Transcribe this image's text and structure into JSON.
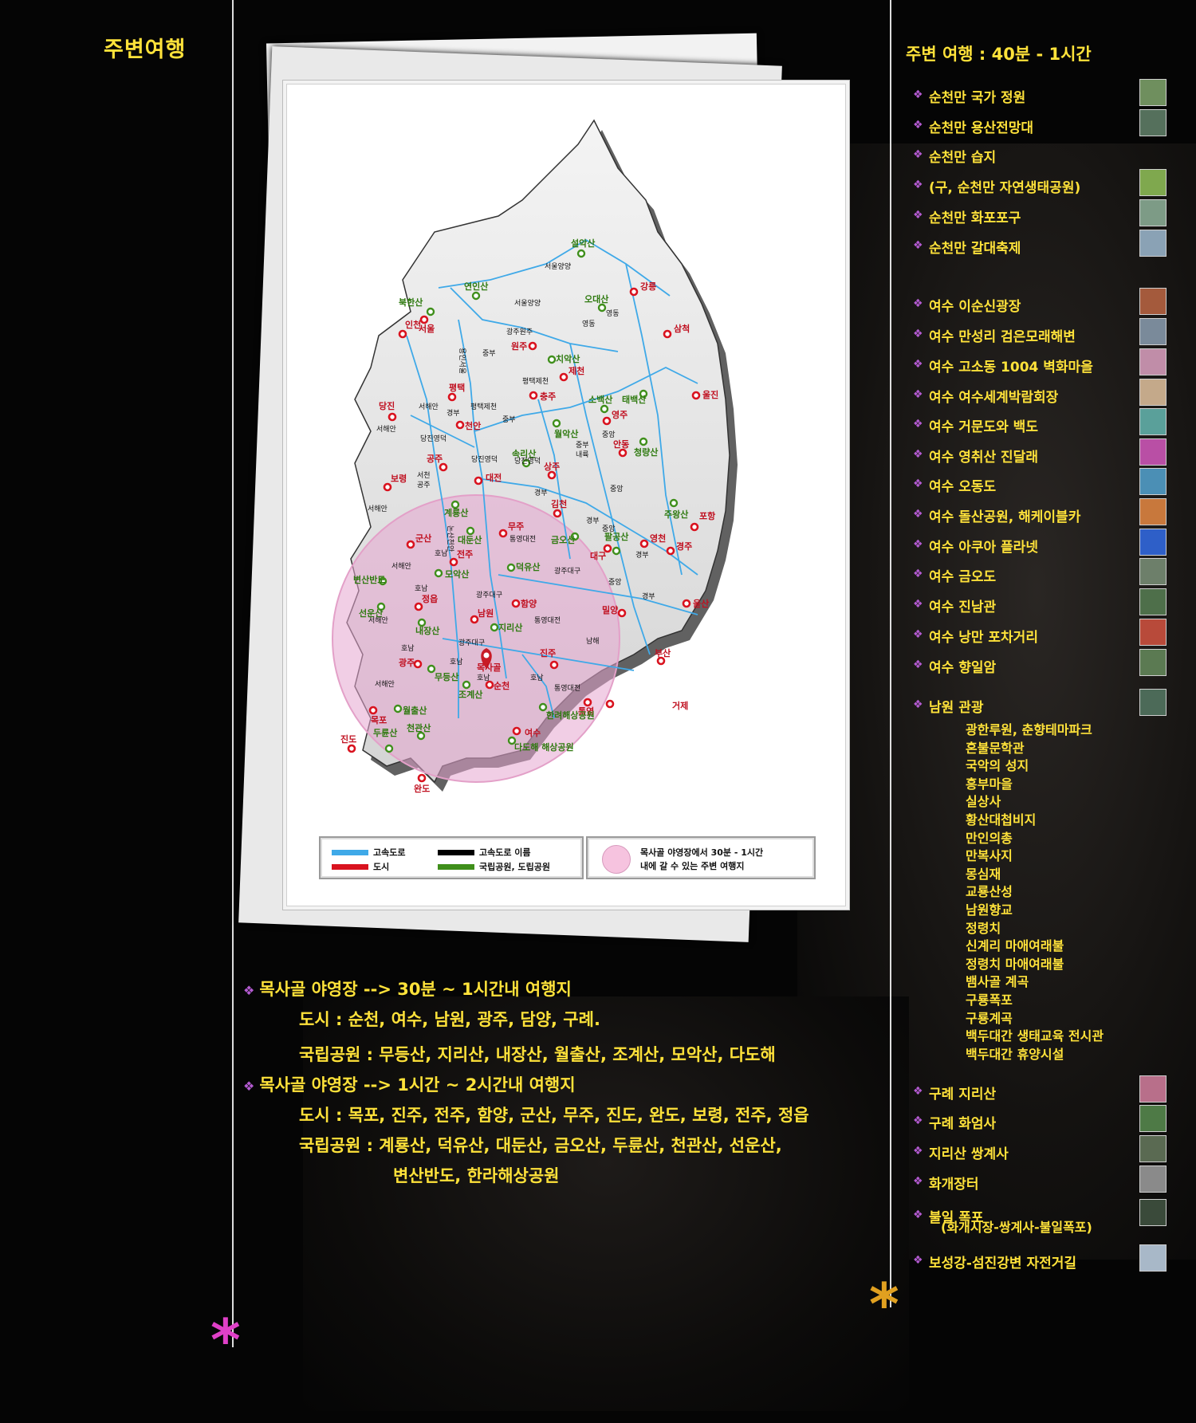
{
  "sidebar": {
    "title": "주변여행"
  },
  "right": {
    "title": "주변 여행 : 40분 - 1시간",
    "items": [
      {
        "label": "순천만 국가 정원",
        "thumb": "#6f8f5e"
      },
      {
        "label": "순천만 용산전망대",
        "thumb": "#55705c"
      },
      {
        "label": "순천만 습지",
        "thumb": ""
      },
      {
        "label": "(구, 순천만 자연생태공원)",
        "thumb": "#7fa84e"
      },
      {
        "label": "순천만 화포포구",
        "thumb": "#7d9b86"
      },
      {
        "label": "순천만 갈대축제",
        "thumb": "#8aa2b5"
      },
      {
        "label": "여수 이순신광장",
        "thumb": "#a45a3c"
      },
      {
        "label": "여수 만성리 검은모래해변",
        "thumb": "#7a8a9a"
      },
      {
        "label": "여수 고소동 1004 벽화마을",
        "thumb": "#c08da8"
      },
      {
        "label": "여수 여수세계박람회장",
        "thumb": "#c4a98a"
      },
      {
        "label": "여수 거문도와 백도",
        "thumb": "#5aa09a"
      },
      {
        "label": "여수 영취산 진달래",
        "thumb": "#b94fa5"
      },
      {
        "label": "여수 오동도",
        "thumb": "#4b8fb5"
      },
      {
        "label": "여수 돌산공원, 해케이블카",
        "thumb": "#c8783c"
      },
      {
        "label": "여수 아쿠아 플라넷",
        "thumb": "#2e5fc8"
      },
      {
        "label": "여수 금오도",
        "thumb": "#6d7f6a"
      },
      {
        "label": "여수 진남관",
        "thumb": "#4e6f4a"
      },
      {
        "label": "여수 낭만 포차거리",
        "thumb": "#b84a3a"
      },
      {
        "label": "여수 향일암",
        "thumb": "#5b7a52"
      },
      {
        "label": "남원 관광",
        "thumb": "#4c6a58"
      }
    ],
    "namwon_subs": [
      "광한루원, 춘향테마파크",
      "혼불문학관",
      "국악의 성지",
      "흥부마을",
      "실상사",
      "황산대첩비지",
      "만인의총",
      "만복사지",
      "몽심재",
      "교룡산성",
      "남원향교",
      "정령치",
      "신계리 마애여래불",
      "정령치 마애여래불",
      "뱀사골 계곡",
      "구룡폭포",
      "구룡계곡",
      "백두대간 생태교육 전시관",
      "백두대간 휴양시설"
    ],
    "items2": [
      {
        "label": "구례 지리산",
        "thumb": "#b86f8a"
      },
      {
        "label": "구례 화엄사",
        "thumb": "#4e7a46"
      },
      {
        "label": "지리산 쌍계사",
        "thumb": "#5a6a52"
      },
      {
        "label": "화개장터",
        "thumb": "#8a8a8a"
      },
      {
        "label": "불일 폭포",
        "thumb": "#3a4a3a"
      },
      {
        "label": "보성강-섬진강변 자전거길",
        "thumb": "#a8b8c8"
      }
    ],
    "bulil_note": "(화개시장-쌍계사-불일폭포)"
  },
  "info": {
    "line1": "목사골 야영장 -->  30분 ~ 1시간내 여행지",
    "line2": "도시 : 순천, 여수, 남원, 광주, 담양, 구례.",
    "line3": "국립공원 : 무등산, 지리산, 내장산, 월출산, 조계산, 모악산, 다도해",
    "line4": "목사골 야영장 -->  1시간 ~ 2시간내 여행지",
    "line5": "도시 : 목포, 진주, 전주, 함양, 군산, 무주, 진도, 완도, 보령, 전주, 정읍",
    "line6": "국립공원 : 계룡산, 덕유산, 대둔산, 금오산, 두륜산, 천관산, 선운산,",
    "line7": "변산반도, 한라해상공원"
  },
  "legend": {
    "highway": "고속도로",
    "city": "도시",
    "highway_name": "고속도로 이름",
    "park": "국립공원, 도립공원",
    "circle_line1": "목사골 야영장에서 30분 - 1시간",
    "circle_line2": "내에 갈 수 있는 주변 여행지",
    "colors": {
      "highway": "#3fa9e8",
      "city": "#d9131f",
      "highway_name": "#000000",
      "park": "#3f8f1b"
    }
  },
  "map": {
    "cities": [
      "인천",
      "서울",
      "강릉",
      "삼척",
      "원주",
      "제천",
      "평택",
      "충주",
      "당진",
      "천안",
      "영주",
      "울진",
      "안동",
      "공주",
      "대전",
      "상주",
      "보령",
      "김천",
      "포항",
      "군산",
      "무주",
      "전주",
      "영천",
      "경주",
      "대구",
      "정읍",
      "함양",
      "밀양",
      "울산",
      "남원",
      "진주",
      "부산",
      "광주",
      "목사골",
      "순천",
      "거제",
      "통영",
      "목포",
      "여수",
      "진도",
      "완도"
    ],
    "parks": [
      "설악산",
      "연인산",
      "북한산",
      "오대산",
      "치악산",
      "소백산",
      "태백산",
      "월악산",
      "청량산",
      "속리산",
      "계룡산",
      "주왕산",
      "대둔산",
      "금오산",
      "팔공산",
      "덕유산",
      "변산반도",
      "모악산",
      "선운산",
      "내장산",
      "지리산",
      "무등산",
      "조계산",
      "한려해상공원",
      "월출산",
      "천관산",
      "두륜산",
      "다도해 해상공원"
    ],
    "roads": [
      "서울양양",
      "영동",
      "광주원주",
      "중부",
      "평택제천",
      "서해안",
      "경부",
      "당진영덕",
      "중앙",
      "호남",
      "논산천안",
      "서천공주",
      "통영대전",
      "광주대구",
      "남해"
    ]
  }
}
